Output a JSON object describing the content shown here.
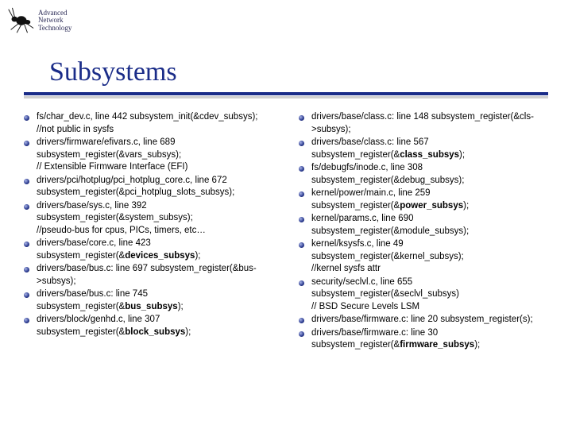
{
  "logo": {
    "line1": "Advanced",
    "line2": "Network",
    "line3": "Technology"
  },
  "title": "Subsystems",
  "left": [
    [
      {
        "t": "fs/char_dev.c, line 442 subsystem_init(&cdev_subsys);"
      },
      {
        "br": 1
      },
      {
        "t": "//not public in sysfs"
      }
    ],
    [
      {
        "t": "drivers/firmware/efivars.c, line 689 subsystem_register(&vars_subsys);"
      },
      {
        "br": 1
      },
      {
        "t": "// Extensible Firmware Interface (EFI)"
      }
    ],
    [
      {
        "t": "drivers/pci/hotplug/pci_hotplug_core.c, line 672 subsystem_register(&pci_hotplug_slots_subsys);"
      }
    ],
    [
      {
        "t": "drivers/base/sys.c, line 392 subsystem_register(&system_subsys);"
      },
      {
        "br": 1
      },
      {
        "t": "//pseudo-bus for cpus, PICs, timers, etc…"
      }
    ],
    [
      {
        "t": "drivers/base/core.c, line 423 subsystem_register(&"
      },
      {
        "t": "devices_subsys",
        "b": 1
      },
      {
        "t": ");"
      }
    ],
    [
      {
        "t": "drivers/base/bus.c: line 697 subsystem_register(&bus->subsys);"
      }
    ],
    [
      {
        "t": "drivers/base/bus.c: line 745 subsystem_register(&"
      },
      {
        "t": "bus_subsys",
        "b": 1
      },
      {
        "t": ");"
      }
    ],
    [
      {
        "t": "drivers/block/genhd.c, line 307 subsystem_register(&"
      },
      {
        "t": "block_subsys",
        "b": 1
      },
      {
        "t": ");"
      }
    ]
  ],
  "right": [
    [
      {
        "t": "drivers/base/class.c: line 148 subsystem_register(&cls->subsys);"
      }
    ],
    [
      {
        "t": "drivers/base/class.c: line 567 subsystem_register(&"
      },
      {
        "t": "class_subsys",
        "b": 1
      },
      {
        "t": ");"
      }
    ],
    [
      {
        "t": "fs/debugfs/inode.c, line 308 subsystem_register(&debug_subsys);"
      }
    ],
    [
      {
        "t": "kernel/power/main.c, line 259 subsystem_register(&"
      },
      {
        "t": "power_subsys",
        "b": 1
      },
      {
        "t": ");"
      }
    ],
    [
      {
        "t": "kernel/params.c, line 690 subsystem_register(&module_subsys);"
      }
    ],
    [
      {
        "t": "kernel/ksysfs.c, line 49 subsystem_register(&kernel_subsys);"
      },
      {
        "br": 1
      },
      {
        "t": "//kernel sysfs attr"
      }
    ],
    [
      {
        "t": "security/seclvl.c, line 655 subsystem_register(&seclvl_subsys)"
      },
      {
        "br": 1
      },
      {
        "t": "// BSD Secure Levels LSM"
      }
    ],
    [
      {
        "t": "drivers/base/firmware.c: line 20 subsystem_register(s);"
      }
    ],
    [
      {
        "t": "drivers/base/firmware.c: line 30 subsystem_register(&"
      },
      {
        "t": "firmware_subsys",
        "b": 1
      },
      {
        "t": ");"
      }
    ]
  ]
}
